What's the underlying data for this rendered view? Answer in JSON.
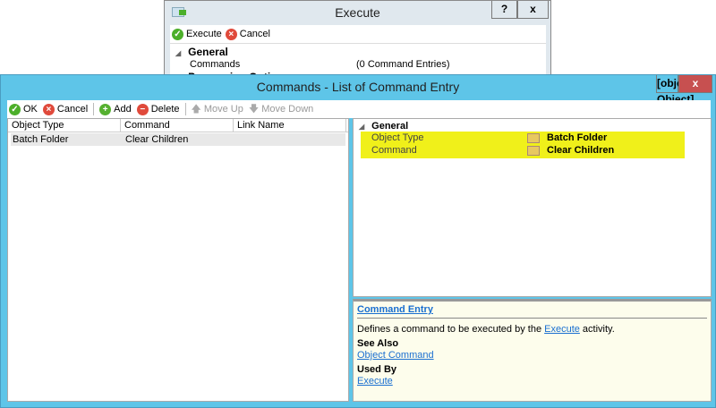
{
  "execute_window": {
    "title": "Execute",
    "help": "?",
    "close": "x",
    "toolbar": {
      "execute": "Execute",
      "cancel": "Cancel"
    },
    "grid": {
      "category": "General",
      "rows": [
        {
          "name": "Commands",
          "value": "(0 Command Entries)"
        }
      ],
      "category2": "Processing Options"
    }
  },
  "commands_window": {
    "title": "Commands - List of Command Entry",
    "help": {
      "title": "Command Entry",
      "desc_before": "Defines a command to be executed by the ",
      "desc_link": "Execute",
      "desc_after": " activity.",
      "see_also": "See Also",
      "see_also_link": "Object Command",
      "used_by": "Used By",
      "used_by_link": "Execute"
    },
    "close": "x",
    "toolbar": {
      "ok": "OK",
      "cancel": "Cancel",
      "add": "Add",
      "delete": "Delete",
      "move_up": "Move Up",
      "move_down": "Move Down"
    },
    "list": {
      "columns": [
        "Object Type",
        "Command",
        "Link Name"
      ],
      "rows": [
        [
          "Batch Folder",
          "Clear Children",
          ""
        ]
      ]
    },
    "properties": {
      "category": "General",
      "rows": [
        {
          "name": "Object Type",
          "value": "Batch Folder",
          "icon": "batch-folder-icon"
        },
        {
          "name": "Command",
          "value": "Clear Children",
          "icon": "clear-children-icon"
        }
      ],
      "highlight_color": "#f0f01a"
    }
  }
}
